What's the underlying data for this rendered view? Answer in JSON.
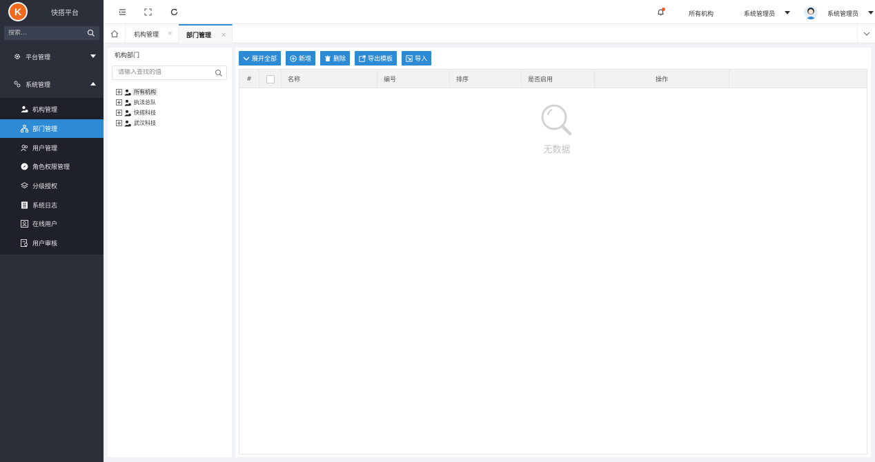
{
  "app": {
    "name": "快搭平台",
    "logo_letter": "K"
  },
  "sidebar": {
    "search_placeholder": "搜索...",
    "groups": [
      {
        "label": "平台管理",
        "icon": "gear-icon",
        "expanded": false
      },
      {
        "label": "系统管理",
        "icon": "link-icon",
        "expanded": true
      }
    ],
    "items": [
      {
        "label": "机构管理",
        "icon": "org-users-icon"
      },
      {
        "label": "部门管理",
        "icon": "org-chart-icon",
        "active": true
      },
      {
        "label": "用户管理",
        "icon": "users-icon"
      },
      {
        "label": "角色权限管理",
        "icon": "compass-icon"
      },
      {
        "label": "分级授权",
        "icon": "layers-icon"
      },
      {
        "label": "系统日志",
        "icon": "log-icon"
      },
      {
        "label": "在线用户",
        "icon": "user-card-icon"
      },
      {
        "label": "用户审核",
        "icon": "audit-icon"
      }
    ]
  },
  "header": {
    "org_label": "所有机构",
    "role_label": "系统管理员",
    "user_name": "系统管理员"
  },
  "tabs": [
    {
      "label": "机构管理",
      "active": false
    },
    {
      "label": "部门管理",
      "active": true
    }
  ],
  "left_panel": {
    "title": "机构部门",
    "search_placeholder": "请输入查找的值",
    "tree": [
      {
        "label": "所有机构",
        "selected": true
      },
      {
        "label": "执法总队"
      },
      {
        "label": "快搭科技"
      },
      {
        "label": "武汉科技"
      }
    ]
  },
  "toolbar": {
    "expand_all": "展开全部",
    "add": "新增",
    "delete": "删除",
    "export_template": "导出模板",
    "import": "导入"
  },
  "table": {
    "columns": [
      "#",
      "",
      "名称",
      "编号",
      "排序",
      "是否启用",
      "操作"
    ],
    "empty_text": "无数据"
  },
  "colors": {
    "accent": "#2d8bd6",
    "sidebar_bg": "#2b2f3a",
    "logo": "#f06a1e",
    "badge": "#ff5722"
  }
}
